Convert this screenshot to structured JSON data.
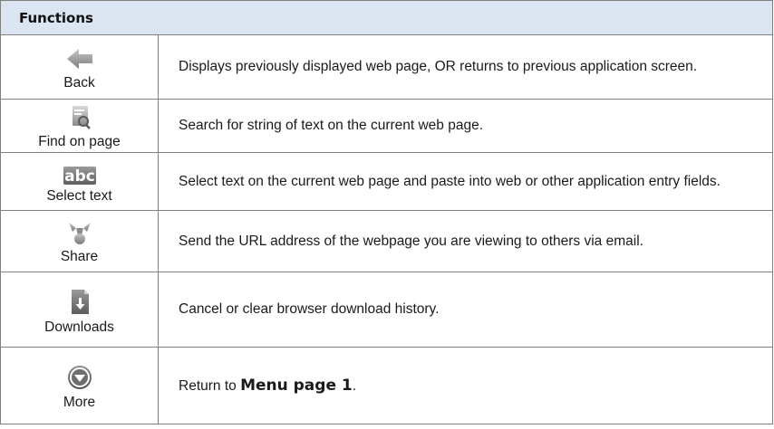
{
  "header": {
    "title": "Functions"
  },
  "rows": [
    {
      "icon": "back-arrow-icon",
      "label": "Back",
      "desc": "Displays previously displayed web page, OR returns to previous application screen."
    },
    {
      "icon": "find-on-page-icon",
      "label": "Find on page",
      "desc": "Search for string of text on the current web page."
    },
    {
      "icon": "select-text-icon",
      "label": "Select text",
      "icon_text": "abc",
      "desc": "Select text on the current web page and paste into web or other application entry fields."
    },
    {
      "icon": "share-icon",
      "label": "Share",
      "desc": "Send the URL address of the webpage you are viewing to others via email."
    },
    {
      "icon": "downloads-icon",
      "label": "Downloads",
      "desc": "Cancel or clear browser download history."
    },
    {
      "icon": "more-icon",
      "label": "More",
      "desc_prefix": "Return to ",
      "desc_bold": "Menu page 1",
      "desc_suffix": "."
    }
  ]
}
